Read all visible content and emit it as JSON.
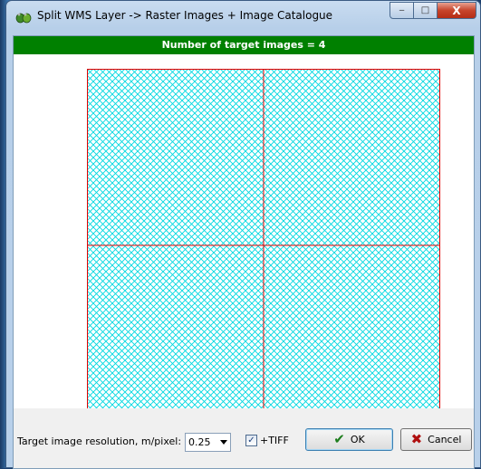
{
  "window": {
    "title": "Split WMS Layer -> Raster Images + Image Catalogue",
    "minimize": "‒",
    "maximize": "□",
    "close": "X"
  },
  "banner": {
    "text": "Number of target images = 4"
  },
  "grid": {
    "rows": 2,
    "cols": 2,
    "hatch_color": "#00d8e0",
    "line_color": "#e00000"
  },
  "bottom": {
    "resolution_label": "Target image resolution, m/pixel:",
    "resolution_value": "0.25",
    "tiff_checked": true,
    "tiff_label": "+TIFF",
    "ok_label": "OK",
    "cancel_label": "Cancel"
  },
  "icons": {
    "app": "frogs-icon",
    "ok": "check-icon",
    "cancel": "x-icon"
  }
}
